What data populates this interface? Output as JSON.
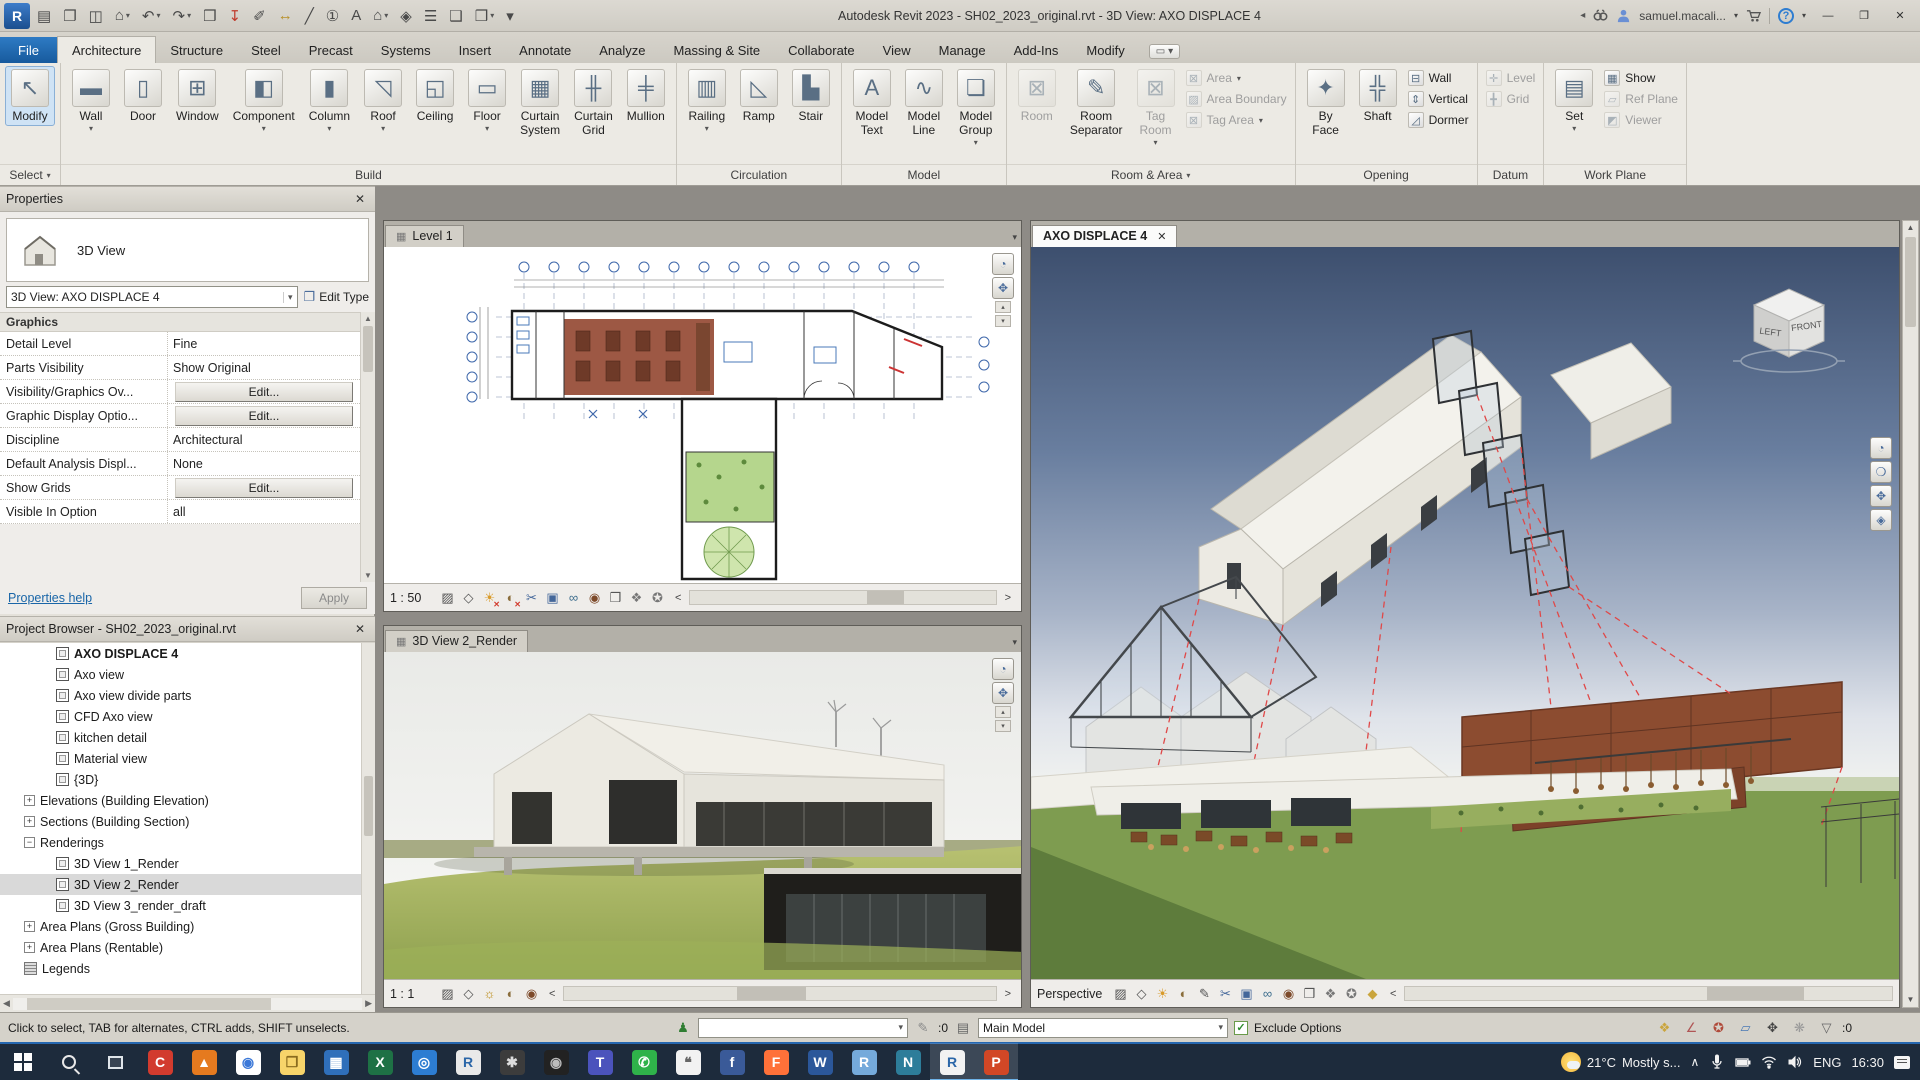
{
  "glyphs": {
    "close": "✕",
    "dropdown": "▾",
    "up": "▲",
    "down": "▼",
    "left": "◀",
    "right": "▶",
    "chev_left": "<",
    "chev_right": ">",
    "minimize": "—",
    "restore": "❐",
    "back": "◂",
    "chevron_up": "∧"
  },
  "title_bar": {
    "title": "Autodesk Revit 2023 - SH02_2023_original.rvt - 3D View: AXO DISPLACE 4",
    "user": "samuel.macali...",
    "help": "?",
    "qat": [
      {
        "name": "revit-app-icon",
        "glyph": "R",
        "cls": "qat-revit"
      },
      {
        "name": "properties-palette-icon",
        "glyph": "▤"
      },
      {
        "name": "open-icon",
        "glyph": "❐"
      },
      {
        "name": "save-icon",
        "glyph": "◫"
      },
      {
        "name": "sync-with-central-icon",
        "glyph": "⌂",
        "arrow": true
      },
      {
        "name": "undo-icon",
        "glyph": "↶",
        "arrow": true
      },
      {
        "name": "redo-icon",
        "glyph": "↷",
        "arrow": true
      },
      {
        "name": "print-icon",
        "glyph": "❒"
      },
      {
        "name": "export-pdf-icon",
        "glyph": "↧",
        "color": "#c0392b"
      },
      {
        "name": "measure-icon",
        "glyph": "✐"
      },
      {
        "name": "aligned-dimension-icon",
        "glyph": "↔",
        "color": "#b8912a"
      },
      {
        "name": "detail-line-icon",
        "glyph": "╱"
      },
      {
        "name": "tag-by-category-icon",
        "glyph": "①"
      },
      {
        "name": "text-icon",
        "glyph": "A"
      },
      {
        "name": "default-3d-view-icon",
        "glyph": "⌂",
        "arrow": true
      },
      {
        "name": "section-icon",
        "glyph": "◈"
      },
      {
        "name": "thin-lines-icon",
        "glyph": "☰"
      },
      {
        "name": "close-inactive-windows-icon",
        "glyph": "❑"
      },
      {
        "name": "switch-windows-icon",
        "glyph": "❒",
        "arrow": true
      },
      {
        "name": "customize-qat-icon",
        "glyph": "▾"
      }
    ]
  },
  "ribbon": {
    "tabs": [
      {
        "label": "File",
        "cls": "file"
      },
      {
        "label": "Architecture",
        "cls": "active"
      },
      {
        "label": "Structure"
      },
      {
        "label": "Steel"
      },
      {
        "label": "Precast"
      },
      {
        "label": "Systems"
      },
      {
        "label": "Insert"
      },
      {
        "label": "Annotate"
      },
      {
        "label": "Analyze"
      },
      {
        "label": "Massing & Site"
      },
      {
        "label": "Collaborate"
      },
      {
        "label": "View"
      },
      {
        "label": "Manage"
      },
      {
        "label": "Add-Ins"
      },
      {
        "label": "Modify"
      }
    ],
    "tab_overflow": {
      "glyph": "▭",
      "arrow": "▾"
    },
    "panels": [
      {
        "label": "Select",
        "arrow": true,
        "groups": [
          {
            "kind": "large",
            "buttons": [
              {
                "label": "Modify",
                "icon": "↖",
                "selected": true
              }
            ]
          }
        ]
      },
      {
        "label": "Build",
        "groups": [
          {
            "kind": "large",
            "buttons": [
              {
                "label": "Wall",
                "icon": "▬",
                "arrow": true
              },
              {
                "label": "Door",
                "icon": "▯"
              },
              {
                "label": "Window",
                "icon": "⊞"
              },
              {
                "label": "Component",
                "icon": "◧",
                "arrow": true
              },
              {
                "label": "Column",
                "icon": "▮",
                "arrow": true
              },
              {
                "label": "Roof",
                "icon": "◹",
                "arrow": true
              },
              {
                "label": "Ceiling",
                "icon": "◱"
              },
              {
                "label": "Floor",
                "icon": "▭",
                "arrow": true
              },
              {
                "label": "Curtain\nSystem",
                "icon": "▦"
              },
              {
                "label": "Curtain\nGrid",
                "icon": "╫"
              },
              {
                "label": "Mullion",
                "icon": "╪"
              }
            ]
          }
        ]
      },
      {
        "label": "Circulation",
        "groups": [
          {
            "kind": "large",
            "buttons": [
              {
                "label": "Railing",
                "icon": "▥",
                "arrow": true
              },
              {
                "label": "Ramp",
                "icon": "◺"
              },
              {
                "label": "Stair",
                "icon": "▙"
              }
            ]
          }
        ]
      },
      {
        "label": "Model",
        "groups": [
          {
            "kind": "large",
            "buttons": [
              {
                "label": "Model\nText",
                "icon": "A"
              },
              {
                "label": "Model\nLine",
                "icon": "∿"
              },
              {
                "label": "Model\nGroup",
                "icon": "❏",
                "arrow": true
              }
            ]
          }
        ]
      },
      {
        "label": "Room & Area",
        "arrow": true,
        "groups": [
          {
            "kind": "large",
            "buttons": [
              {
                "label": "Room",
                "icon": "⊠",
                "disabled": true
              },
              {
                "label": "Room\nSeparator",
                "icon": "✎"
              },
              {
                "label": "Tag\nRoom",
                "icon": "⊠",
                "arrow": true,
                "disabled": true
              }
            ]
          },
          {
            "kind": "stack",
            "buttons": [
              {
                "label": "Area",
                "icon": "⊠",
                "arrow": true,
                "disabled": true
              },
              {
                "label": "Area Boundary",
                "icon": "▨",
                "disabled": true
              },
              {
                "label": "Tag Area",
                "icon": "⊠",
                "arrow": true,
                "disabled": true
              }
            ]
          }
        ]
      },
      {
        "label": "Opening",
        "groups": [
          {
            "kind": "large",
            "buttons": [
              {
                "label": "By\nFace",
                "icon": "✦"
              },
              {
                "label": "Shaft",
                "icon": "╬"
              }
            ]
          },
          {
            "kind": "stack",
            "buttons": [
              {
                "label": "Wall",
                "icon": "⊟"
              },
              {
                "label": "Vertical",
                "icon": "⇕"
              },
              {
                "label": "Dormer",
                "icon": "◿"
              }
            ]
          }
        ]
      },
      {
        "label": "Datum",
        "groups": [
          {
            "kind": "stack",
            "buttons": [
              {
                "label": "Level",
                "icon": "✛",
                "disabled": true
              },
              {
                "label": "Grid",
                "icon": "╋",
                "disabled": true
              }
            ]
          }
        ]
      },
      {
        "label": "Work Plane",
        "groups": [
          {
            "kind": "large",
            "buttons": [
              {
                "label": "Set",
                "icon": "▤",
                "arrow": true
              }
            ]
          },
          {
            "kind": "stack",
            "buttons": [
              {
                "label": "Show",
                "icon": "▦"
              },
              {
                "label": "Ref Plane",
                "icon": "▱",
                "disabled": true
              },
              {
                "label": "Viewer",
                "icon": "◩",
                "disabled": true
              }
            ]
          }
        ]
      }
    ]
  },
  "properties": {
    "header": "Properties",
    "type_label": "3D View",
    "selector": "3D View: AXO DISPLACE 4",
    "edit_type": "Edit Type",
    "section": "Graphics",
    "rows": [
      {
        "label": "Detail Level",
        "value": "Fine"
      },
      {
        "label": "Parts Visibility",
        "value": "Show Original"
      },
      {
        "label": "Visibility/Graphics Ov...",
        "value": "Edit...",
        "type": "button"
      },
      {
        "label": "Graphic Display Optio...",
        "value": "Edit...",
        "type": "button"
      },
      {
        "label": "Discipline",
        "value": "Architectural"
      },
      {
        "label": "Default Analysis Displ...",
        "value": "None"
      },
      {
        "label": "Show Grids",
        "value": "Edit...",
        "type": "button"
      },
      {
        "label": "Visible In Option",
        "value": "all"
      }
    ],
    "help": "Properties help",
    "apply": "Apply"
  },
  "project_browser": {
    "header": "Project Browser - SH02_2023_original.rvt",
    "items": [
      {
        "label": "AXO DISPLACE 4",
        "lvl": 3,
        "icon": "view",
        "bold": true
      },
      {
        "label": "Axo view",
        "lvl": 3,
        "icon": "view"
      },
      {
        "label": "Axo view divide parts",
        "lvl": 3,
        "icon": "view"
      },
      {
        "label": "CFD Axo view",
        "lvl": 3,
        "icon": "view"
      },
      {
        "label": "kitchen detail",
        "lvl": 3,
        "icon": "view"
      },
      {
        "label": "Material view",
        "lvl": 3,
        "icon": "view"
      },
      {
        "label": "{3D}",
        "lvl": 3,
        "icon": "view"
      },
      {
        "label": "Elevations (Building Elevation)",
        "lvl": 1,
        "exp": "plus"
      },
      {
        "label": "Sections (Building Section)",
        "lvl": 1,
        "exp": "plus"
      },
      {
        "label": "Renderings",
        "lvl": 1,
        "exp": "minus"
      },
      {
        "label": "3D View 1_Render",
        "lvl": 3,
        "icon": "view"
      },
      {
        "label": "3D View 2_Render",
        "lvl": 3,
        "icon": "view",
        "selected": true
      },
      {
        "label": "3D View 3_render_draft",
        "lvl": 3,
        "icon": "view"
      },
      {
        "label": "Area Plans (Gross Building)",
        "lvl": 1,
        "exp": "plus"
      },
      {
        "label": "Area Plans (Rentable)",
        "lvl": 1,
        "exp": "plus"
      },
      {
        "label": "Legends",
        "lvl": 1,
        "icon": "legend"
      }
    ]
  },
  "viewports": {
    "plan": {
      "title": "Level 1",
      "tab_icon": "▦",
      "scale": "1 : 50",
      "icons": [
        {
          "name": "visual-style-icon",
          "glyph": "▨",
          "color": "#555"
        },
        {
          "name": "detail-level-icon",
          "glyph": "◇",
          "color": "#555"
        },
        {
          "name": "sun-path-icon",
          "glyph": "☀",
          "color": "#d99b2b",
          "badge": "✕"
        },
        {
          "name": "shadows-icon",
          "glyph": "◐",
          "color": "#8a6d3b",
          "badge": "✕"
        },
        {
          "name": "crop-view-icon",
          "glyph": "✂",
          "color": "#44679a"
        },
        {
          "name": "show-crop-region-icon",
          "glyph": "▣",
          "color": "#44679a"
        },
        {
          "name": "temporary-hide-isolate-icon",
          "glyph": "∞",
          "color": "#3e6e8e"
        },
        {
          "name": "reveal-hidden-elements-icon",
          "glyph": "◉",
          "color": "#7d4a2a"
        },
        {
          "name": "temporary-view-properties-icon",
          "glyph": "❒",
          "color": "#555"
        },
        {
          "name": "analytical-model-icon",
          "glyph": "❖",
          "color": "#777"
        },
        {
          "name": "constraints-icon",
          "glyph": "✪",
          "color": "#777"
        }
      ]
    },
    "render": {
      "title": "3D View 2_Render",
      "tab_icon": "▦",
      "scale": "1 : 1",
      "icons": [
        {
          "name": "visual-style-icon",
          "glyph": "▨",
          "color": "#555"
        },
        {
          "name": "detail-level-icon",
          "glyph": "◇",
          "color": "#555"
        },
        {
          "name": "show-rendering-dialog-icon",
          "glyph": "☼",
          "color": "#b8860b"
        },
        {
          "name": "shadows-icon",
          "glyph": "◐",
          "color": "#8a6d3b"
        },
        {
          "name": "reveal-hidden-elements-icon",
          "glyph": "◉",
          "color": "#7d4a2a"
        }
      ]
    },
    "axo": {
      "title": "AXO DISPLACE 4",
      "mode": "Perspective",
      "viewcube": {
        "left": "LEFT",
        "front": "FRONT"
      },
      "icons": [
        {
          "name": "visual-style-icon",
          "glyph": "▨",
          "color": "#555"
        },
        {
          "name": "detail-level-icon",
          "glyph": "◇",
          "color": "#555"
        },
        {
          "name": "sun-path-icon",
          "glyph": "☀",
          "color": "#d99b2b"
        },
        {
          "name": "shadows-icon",
          "glyph": "◐",
          "color": "#8a6d3b"
        },
        {
          "name": "sketchy-lines-icon",
          "glyph": "✎",
          "color": "#555"
        },
        {
          "name": "crop-view-icon",
          "glyph": "✂",
          "color": "#44679a"
        },
        {
          "name": "show-crop-region-icon",
          "glyph": "▣",
          "color": "#44679a"
        },
        {
          "name": "temporary-hide-isolate-icon",
          "glyph": "∞",
          "color": "#3e6e8e"
        },
        {
          "name": "reveal-hidden-elements-icon",
          "glyph": "◉",
          "color": "#7d4a2a"
        },
        {
          "name": "temporary-view-properties-icon",
          "glyph": "❒",
          "color": "#555"
        },
        {
          "name": "analytical-model-icon",
          "glyph": "❖",
          "color": "#777"
        },
        {
          "name": "constraints-icon",
          "glyph": "✪",
          "color": "#777"
        },
        {
          "name": "worksharing-display-icon",
          "glyph": "◆",
          "color": "#caa53d"
        }
      ]
    }
  },
  "status_bar": {
    "hint": "Click to select, TAB for alternates, CTRL adds, SHIFT unselects.",
    "icon_worksets": "♟",
    "worksets_value": "",
    "icon_editable": "✎",
    "editable_count": ":0",
    "icon_design_options": "▤",
    "active_option": "Main Model",
    "check": "✓",
    "exclude_label": "Exclude Options",
    "filter_count": ":0",
    "right_icons": [
      {
        "name": "worksharing-display-icon",
        "glyph": "❖",
        "color": "#caa53d"
      },
      {
        "name": "reveal-constraints-icon",
        "glyph": "∠",
        "color": "#b05555"
      },
      {
        "name": "select-pinned-icon",
        "glyph": "✪",
        "color": "#b04a3a"
      },
      {
        "name": "select-underlay-icon",
        "glyph": "▱",
        "color": "#4a7ab5"
      },
      {
        "name": "drag-on-selection-icon",
        "glyph": "✥",
        "color": "#444"
      },
      {
        "name": "background-processes-icon",
        "glyph": "❋",
        "color": "#999"
      },
      {
        "name": "filter-icon",
        "glyph": "▽",
        "color": "#666"
      }
    ]
  },
  "taskbar": {
    "apps": [
      {
        "name": "ccleaner",
        "bg": "#d23b2e",
        "fg": "#fff",
        "label": "C"
      },
      {
        "name": "vlc",
        "bg": "#e57a1f",
        "fg": "#fff",
        "label": "▲"
      },
      {
        "name": "chrome",
        "bg": "#ffffff",
        "fg": "#3b78d8",
        "label": "◉"
      },
      {
        "name": "file-explorer",
        "bg": "#f7d46a",
        "fg": "#8a6b1e",
        "label": "❒"
      },
      {
        "name": "calculator",
        "bg": "#2f6fba",
        "fg": "#fff",
        "label": "▦"
      },
      {
        "name": "excel",
        "bg": "#1e7145",
        "fg": "#fff",
        "label": "X"
      },
      {
        "name": "edge",
        "bg": "#2d7dd2",
        "fg": "#fff",
        "label": "◎"
      },
      {
        "name": "revit-viewer",
        "bg": "#e9e9e9",
        "fg": "#2b66a8",
        "label": "R"
      },
      {
        "name": "settings",
        "bg": "#3c3c3c",
        "fg": "#ddd",
        "label": "✱"
      },
      {
        "name": "camera",
        "bg": "#222222",
        "fg": "#bbb",
        "label": "◉"
      },
      {
        "name": "teams",
        "bg": "#4b53bc",
        "fg": "#fff",
        "label": "T"
      },
      {
        "name": "whatsapp",
        "bg": "#2fb24a",
        "fg": "#fff",
        "label": "✆"
      },
      {
        "name": "messages",
        "bg": "#f2f2f2",
        "fg": "#666",
        "label": "❝"
      },
      {
        "name": "facebook",
        "bg": "#3a5a98",
        "fg": "#fff",
        "label": "f"
      },
      {
        "name": "firefox",
        "bg": "#ff7139",
        "fg": "#fff",
        "label": "F"
      },
      {
        "name": "word",
        "bg": "#2b579a",
        "fg": "#fff",
        "label": "W"
      },
      {
        "name": "rstudio",
        "bg": "#75aadb",
        "fg": "#fff",
        "label": "R"
      },
      {
        "name": "notepad",
        "bg": "#2d7d9a",
        "fg": "#fff",
        "label": "N"
      },
      {
        "name": "revit",
        "bg": "#f2f2f2",
        "fg": "#2b66a8",
        "label": "R",
        "active": true
      },
      {
        "name": "powerpoint",
        "bg": "#d24726",
        "fg": "#fff",
        "label": "P",
        "active": true
      }
    ],
    "tray": {
      "temp": "21°C",
      "weather": "Mostly s...",
      "lang": "ENG",
      "time": "16:30"
    }
  }
}
